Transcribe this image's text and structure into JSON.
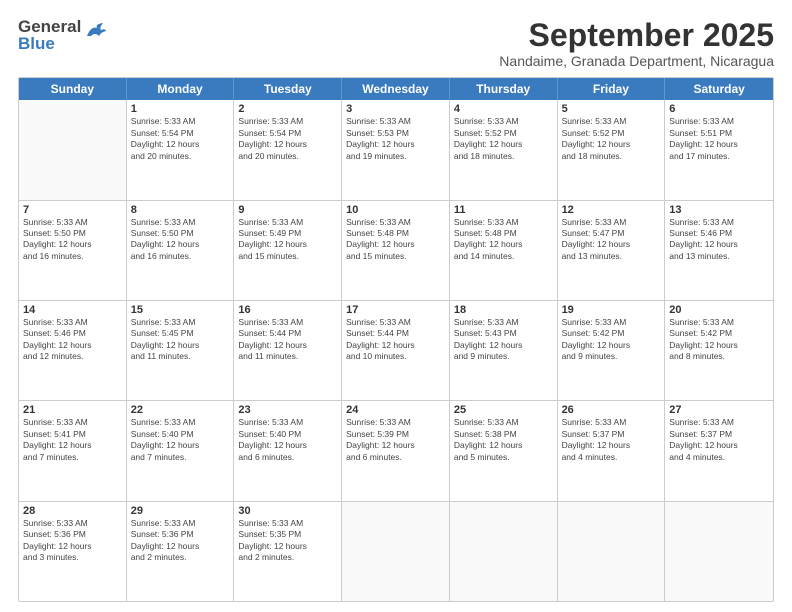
{
  "header": {
    "logo_general": "General",
    "logo_blue": "Blue",
    "title": "September 2025",
    "subtitle": "Nandaime, Granada Department, Nicaragua"
  },
  "days_of_week": [
    "Sunday",
    "Monday",
    "Tuesday",
    "Wednesday",
    "Thursday",
    "Friday",
    "Saturday"
  ],
  "weeks": [
    [
      {
        "day": "",
        "info": ""
      },
      {
        "day": "1",
        "info": "Sunrise: 5:33 AM\nSunset: 5:54 PM\nDaylight: 12 hours\nand 20 minutes."
      },
      {
        "day": "2",
        "info": "Sunrise: 5:33 AM\nSunset: 5:54 PM\nDaylight: 12 hours\nand 20 minutes."
      },
      {
        "day": "3",
        "info": "Sunrise: 5:33 AM\nSunset: 5:53 PM\nDaylight: 12 hours\nand 19 minutes."
      },
      {
        "day": "4",
        "info": "Sunrise: 5:33 AM\nSunset: 5:52 PM\nDaylight: 12 hours\nand 18 minutes."
      },
      {
        "day": "5",
        "info": "Sunrise: 5:33 AM\nSunset: 5:52 PM\nDaylight: 12 hours\nand 18 minutes."
      },
      {
        "day": "6",
        "info": "Sunrise: 5:33 AM\nSunset: 5:51 PM\nDaylight: 12 hours\nand 17 minutes."
      }
    ],
    [
      {
        "day": "7",
        "info": "Sunrise: 5:33 AM\nSunset: 5:50 PM\nDaylight: 12 hours\nand 16 minutes."
      },
      {
        "day": "8",
        "info": "Sunrise: 5:33 AM\nSunset: 5:50 PM\nDaylight: 12 hours\nand 16 minutes."
      },
      {
        "day": "9",
        "info": "Sunrise: 5:33 AM\nSunset: 5:49 PM\nDaylight: 12 hours\nand 15 minutes."
      },
      {
        "day": "10",
        "info": "Sunrise: 5:33 AM\nSunset: 5:48 PM\nDaylight: 12 hours\nand 15 minutes."
      },
      {
        "day": "11",
        "info": "Sunrise: 5:33 AM\nSunset: 5:48 PM\nDaylight: 12 hours\nand 14 minutes."
      },
      {
        "day": "12",
        "info": "Sunrise: 5:33 AM\nSunset: 5:47 PM\nDaylight: 12 hours\nand 13 minutes."
      },
      {
        "day": "13",
        "info": "Sunrise: 5:33 AM\nSunset: 5:46 PM\nDaylight: 12 hours\nand 13 minutes."
      }
    ],
    [
      {
        "day": "14",
        "info": "Sunrise: 5:33 AM\nSunset: 5:46 PM\nDaylight: 12 hours\nand 12 minutes."
      },
      {
        "day": "15",
        "info": "Sunrise: 5:33 AM\nSunset: 5:45 PM\nDaylight: 12 hours\nand 11 minutes."
      },
      {
        "day": "16",
        "info": "Sunrise: 5:33 AM\nSunset: 5:44 PM\nDaylight: 12 hours\nand 11 minutes."
      },
      {
        "day": "17",
        "info": "Sunrise: 5:33 AM\nSunset: 5:44 PM\nDaylight: 12 hours\nand 10 minutes."
      },
      {
        "day": "18",
        "info": "Sunrise: 5:33 AM\nSunset: 5:43 PM\nDaylight: 12 hours\nand 9 minutes."
      },
      {
        "day": "19",
        "info": "Sunrise: 5:33 AM\nSunset: 5:42 PM\nDaylight: 12 hours\nand 9 minutes."
      },
      {
        "day": "20",
        "info": "Sunrise: 5:33 AM\nSunset: 5:42 PM\nDaylight: 12 hours\nand 8 minutes."
      }
    ],
    [
      {
        "day": "21",
        "info": "Sunrise: 5:33 AM\nSunset: 5:41 PM\nDaylight: 12 hours\nand 7 minutes."
      },
      {
        "day": "22",
        "info": "Sunrise: 5:33 AM\nSunset: 5:40 PM\nDaylight: 12 hours\nand 7 minutes."
      },
      {
        "day": "23",
        "info": "Sunrise: 5:33 AM\nSunset: 5:40 PM\nDaylight: 12 hours\nand 6 minutes."
      },
      {
        "day": "24",
        "info": "Sunrise: 5:33 AM\nSunset: 5:39 PM\nDaylight: 12 hours\nand 6 minutes."
      },
      {
        "day": "25",
        "info": "Sunrise: 5:33 AM\nSunset: 5:38 PM\nDaylight: 12 hours\nand 5 minutes."
      },
      {
        "day": "26",
        "info": "Sunrise: 5:33 AM\nSunset: 5:37 PM\nDaylight: 12 hours\nand 4 minutes."
      },
      {
        "day": "27",
        "info": "Sunrise: 5:33 AM\nSunset: 5:37 PM\nDaylight: 12 hours\nand 4 minutes."
      }
    ],
    [
      {
        "day": "28",
        "info": "Sunrise: 5:33 AM\nSunset: 5:36 PM\nDaylight: 12 hours\nand 3 minutes."
      },
      {
        "day": "29",
        "info": "Sunrise: 5:33 AM\nSunset: 5:36 PM\nDaylight: 12 hours\nand 2 minutes."
      },
      {
        "day": "30",
        "info": "Sunrise: 5:33 AM\nSunset: 5:35 PM\nDaylight: 12 hours\nand 2 minutes."
      },
      {
        "day": "",
        "info": ""
      },
      {
        "day": "",
        "info": ""
      },
      {
        "day": "",
        "info": ""
      },
      {
        "day": "",
        "info": ""
      }
    ]
  ]
}
